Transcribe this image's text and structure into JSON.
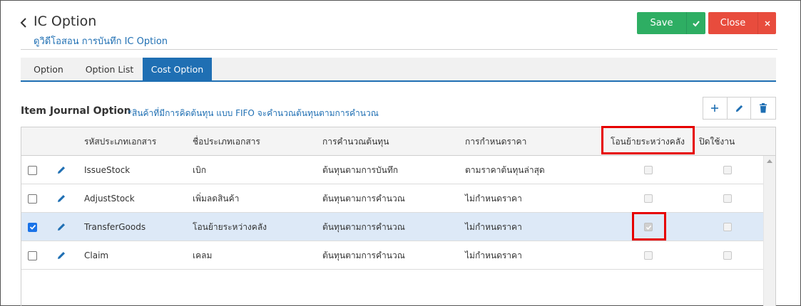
{
  "header": {
    "title": "IC Option",
    "subtitle": "ดูวิดีโอสอน การบันทึก IC Option",
    "save_label": "Save",
    "close_label": "Close"
  },
  "tabs": [
    {
      "label": "Option",
      "active": false
    },
    {
      "label": "Option List",
      "active": false
    },
    {
      "label": "Cost Option",
      "active": true
    }
  ],
  "section": {
    "title": "Item Journal Option",
    "note": "*สินค้าที่มีการคิดต้นทุน แบบ FIFO จะคำนวณต้นทุนตามการคำนวณ"
  },
  "toolbar_icons": [
    "plus-icon",
    "pencil-icon",
    "trash-icon"
  ],
  "table": {
    "columns": [
      "รหัสประเภทเอกสาร",
      "ชื่อประเภทเอกสาร",
      "การคำนวณต้นทุน",
      "การกำหนดราคา",
      "โอนย้ายระหว่างคลัง",
      "ปิดใช้งาน"
    ],
    "rows": [
      {
        "selected": false,
        "code": "IssueStock",
        "name": "เบิก",
        "cost_calc": "ต้นทุนตามการบันทึก",
        "pricing": "ตามราคาต้นทุนล่าสุด",
        "transfer": false,
        "disabled": false
      },
      {
        "selected": false,
        "code": "AdjustStock",
        "name": "เพิ่มลดสินค้า",
        "cost_calc": "ต้นทุนตามการคำนวณ",
        "pricing": "ไม่กำหนดราคา",
        "transfer": false,
        "disabled": false
      },
      {
        "selected": true,
        "code": "TransferGoods",
        "name": "โอนย้ายระหว่างคลัง",
        "cost_calc": "ต้นทุนตามการคำนวณ",
        "pricing": "ไม่กำหนดราคา",
        "transfer": true,
        "disabled": false
      },
      {
        "selected": false,
        "code": "Claim",
        "name": "เคลม",
        "cost_calc": "ต้นทุนตามการคำนวณ",
        "pricing": "ไม่กำหนดราคา",
        "transfer": false,
        "disabled": false
      }
    ]
  },
  "colors": {
    "accent": "#1f6fb3",
    "save": "#2eae63",
    "close": "#e84c3d",
    "highlight": "#e60000",
    "selected_row": "#dde9f7"
  }
}
